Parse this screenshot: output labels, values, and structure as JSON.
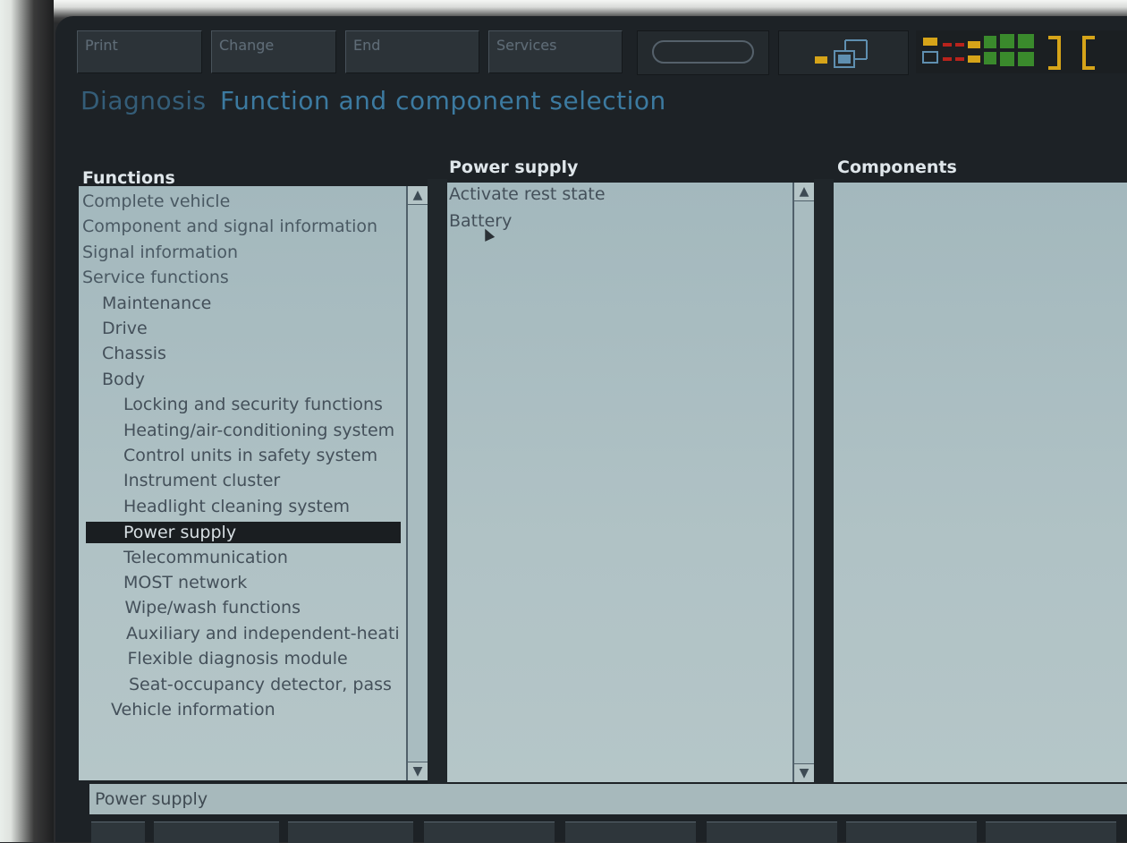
{
  "toolbar": {
    "print": "Print",
    "change": "Change",
    "end": "End",
    "services": "Services"
  },
  "title": {
    "section": "Diagnosis",
    "subtitle": "Function and component selection"
  },
  "functions": {
    "header": "Functions",
    "items": [
      {
        "label": "Complete vehicle"
      },
      {
        "label": "Component and signal information"
      },
      {
        "label": "Signal information"
      },
      {
        "label": "Service functions"
      },
      {
        "label": "Maintenance"
      },
      {
        "label": "Drive"
      },
      {
        "label": "Chassis"
      },
      {
        "label": "Body"
      },
      {
        "label": "Locking and security functions"
      },
      {
        "label": "Heating/air-conditioning system"
      },
      {
        "label": "Control units in safety system"
      },
      {
        "label": "Instrument cluster"
      },
      {
        "label": "Headlight cleaning system"
      },
      {
        "label": "Power supply"
      },
      {
        "label": "Telecommunication"
      },
      {
        "label": "MOST network"
      },
      {
        "label": "Wipe/wash functions"
      },
      {
        "label": "Auxiliary and independent-heati"
      },
      {
        "label": "Flexible diagnosis module"
      },
      {
        "label": "Seat-occupancy detector, pass"
      },
      {
        "label": "Vehicle information"
      }
    ]
  },
  "power_supply": {
    "header": "Power supply",
    "items": [
      {
        "label": "Activate rest state"
      },
      {
        "label": "Battery"
      }
    ]
  },
  "components": {
    "header": "Components"
  },
  "status_bar": {
    "text": "Power supply"
  },
  "colors": {
    "accent_blue": "#3c7aa0",
    "panel_bg": "#a9bcc0",
    "status_green": "#3a8a2c",
    "status_yellow": "#d6a419",
    "status_red": "#b8231c"
  }
}
